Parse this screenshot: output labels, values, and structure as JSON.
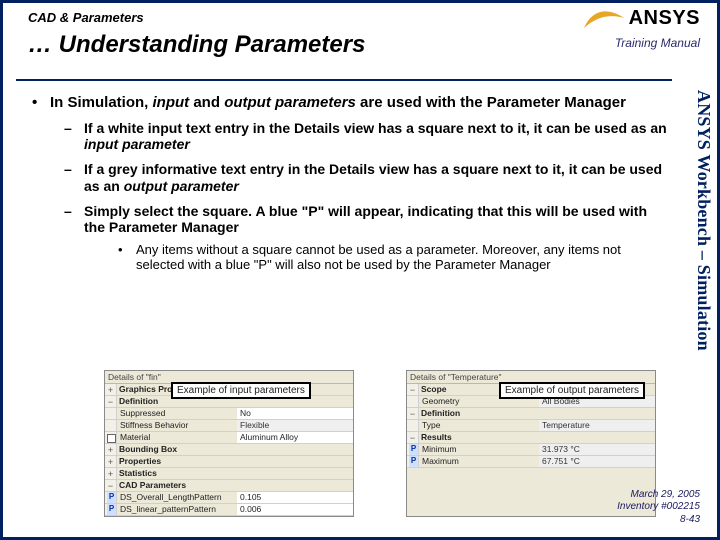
{
  "header": {
    "breadcrumb": "CAD & Parameters",
    "title": "… Understanding Parameters",
    "brand": "ANSYS",
    "training": "Training Manual"
  },
  "sidelabel": "ANSYS Workbench – Simulation",
  "content": {
    "p1_a": "In Simulation, ",
    "p1_b": "input ",
    "p1_c": "and ",
    "p1_d": "output parameters ",
    "p1_e": "are used with the Parameter Manager",
    "d1_a": "If a white input text entry in the Details view has a square next to it, it can be used as an ",
    "d1_b": "input parameter",
    "d2_a": "If a grey informative text entry in the Details view has a square next to it, it can be used as an ",
    "d2_b": "output parameter",
    "d3": "Simply select the square.  A blue \"P\" will appear, indicating that this will be used with the Parameter Manager",
    "s1": "Any items without a square cannot be used as a parameter.  Moreover, any items not selected with a blue \"P\" will also not be used by the Parameter Manager"
  },
  "fig_in": {
    "title": "Details of \"fin\"",
    "callout": "Example of input parameters",
    "cat1": "Graphics Properties",
    "cat2": "Definition",
    "r1k": "Suppressed",
    "r1v": "No",
    "r2k": "Stiffness Behavior",
    "r2v": "Flexible",
    "r3k": "Material",
    "r3v": "Aluminum Alloy",
    "cat3": "Bounding Box",
    "cat4": "Properties",
    "cat5": "Statistics",
    "cat6": "CAD Parameters",
    "r4k": "DS_Overall_LengthPattern",
    "r4v": "0.105",
    "r5k": "DS_linear_patternPattern",
    "r5v": "0.006"
  },
  "fig_out": {
    "title": "Details of \"Temperature\"",
    "callout": "Example of output parameters",
    "cat1": "Scope",
    "r1k": "Geometry",
    "r1v": "All Bodies",
    "cat2": "Definition",
    "r2k": "Type",
    "r2v": "Temperature",
    "cat3": "Results",
    "r3k": "Minimum",
    "r3v": "31.973 °C",
    "r4k": "Maximum",
    "r4v": "67.751 °C"
  },
  "footer": {
    "date": "March 29, 2005",
    "inv": "Inventory #002215",
    "page": "8-43"
  }
}
